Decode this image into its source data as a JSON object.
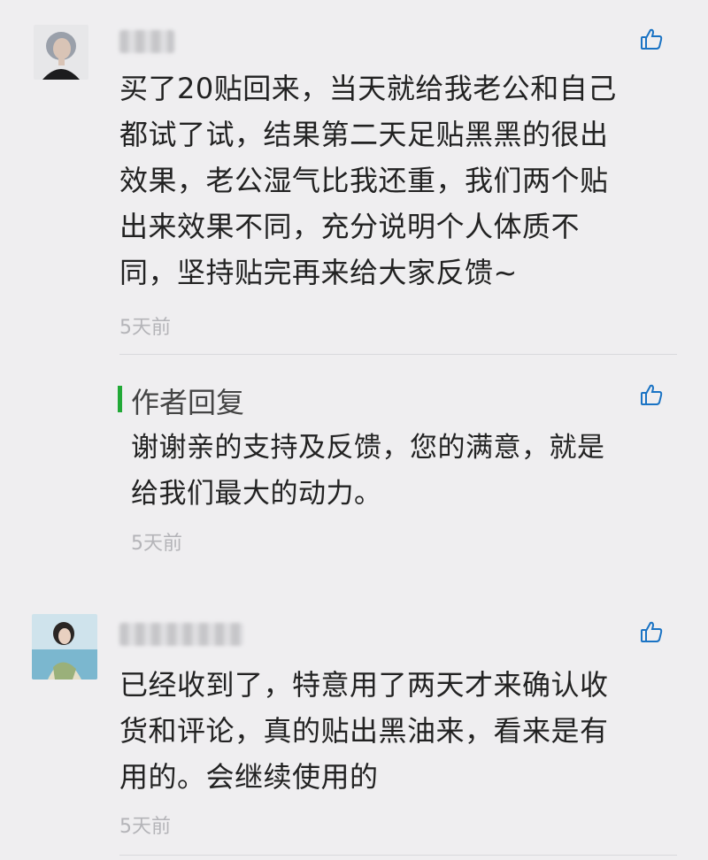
{
  "comments": [
    {
      "text": "买了20贴回来，当天就给我老公和自己\n都试了试，结果第二天足贴黑黑的很出\n效果，老公湿气比我还重，我们两个贴\n出来效果不同，充分说明个人体质不\n同，坚持贴完再来给大家反馈~",
      "time": "5天前",
      "like_icon": "thumbs-up-icon"
    },
    {
      "text": "已经收到了，特意用了两天才来确认收\n货和评论，真的贴出黑油来，看来是有\n用的。会继续使用的",
      "time": "5天前",
      "like_icon": "thumbs-up-icon"
    }
  ],
  "author_reply": {
    "title": "作者回复",
    "text": "谢谢亲的支持及反馈，您的满意，就是\n给我们最大的动力。",
    "time": "5天前",
    "accent_color": "#22a937"
  }
}
